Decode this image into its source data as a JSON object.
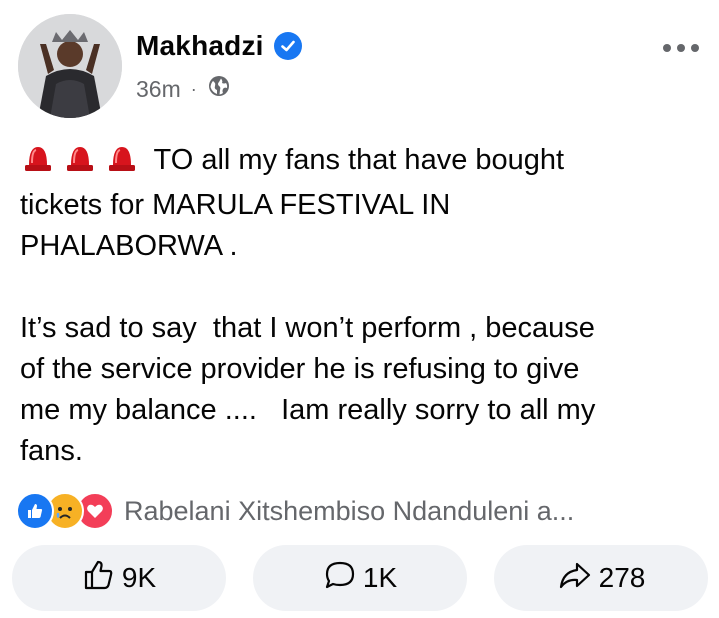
{
  "post": {
    "author": "Makhadzi",
    "time": "36m",
    "separator": "·",
    "privacy_icon": "globe-icon",
    "verified_icon": "verified-badge-icon",
    "more_icon": "more-options-icon",
    "body": {
      "line1": "TO all my fans that have bought",
      "line2": "tickets for MARULA FESTIVAL IN",
      "line3": "PHALABORWA .",
      "line4": "It’s sad to say  that I won’t perform , because",
      "line5": "of the service provider he is refusing to give",
      "line6": "me my balance ....   Iam really sorry to all my",
      "line7": "fans."
    },
    "reactions": {
      "icons": [
        "like-reaction-icon",
        "sad-reaction-icon",
        "care-reaction-icon"
      ],
      "names": "Rabelani Xitshembiso Ndanduleni a..."
    },
    "actions": {
      "like_count": "9K",
      "comment_count": "1K",
      "share_count": "278"
    }
  },
  "colors": {
    "accent": "#1877f2",
    "secondary_text": "#65676b",
    "button_bg": "#f0f2f5",
    "siren_red": "#d7141d"
  }
}
